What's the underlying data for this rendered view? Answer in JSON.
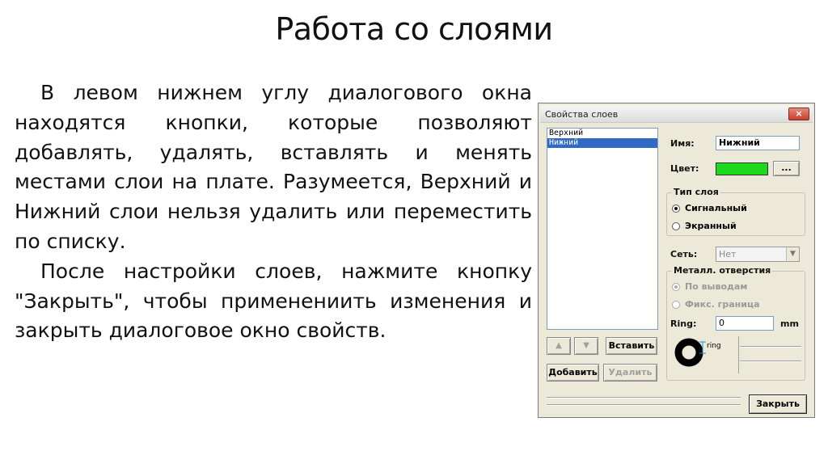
{
  "slide": {
    "title": "Работа со слоями",
    "paragraphs": [
      "В левом нижнем углу диалогового окна находятся кнопки, которые позволяют добавлять, удалять, вставлять и менять местами слои на плате. Разумеется, Верхний и Нижний слои нельзя удалить или переместить по списку.",
      "После настройки слоев, нажмите кнопку \"Закрыть\", чтобы применениить изменения и закрыть диалоговое окно свойств."
    ]
  },
  "dialog": {
    "title": "Свойства слоев",
    "close_glyph": "×",
    "layers": [
      "Верхний",
      "Нижний"
    ],
    "selected_layer": "Нижний",
    "name_label": "Имя:",
    "name_value": "Нижний",
    "color_label": "Цвет:",
    "color_value": "#1ed81e",
    "color_button": "...",
    "layer_type": {
      "legend": "Тип слоя",
      "options": [
        "Сигнальный",
        "Экранный"
      ],
      "selected": "Сигнальный"
    },
    "net_label": "Сеть:",
    "net_value": "Нет",
    "metal_holes": {
      "legend": "Металл. отверстия",
      "options": [
        "По выводам",
        "Фикс. граница"
      ],
      "selected": "По выводам"
    },
    "ring_label": "Ring:",
    "ring_value": "0",
    "ring_unit": "mm",
    "ring_diagram_label": "ring",
    "buttons": {
      "up": "▲",
      "down": "▼",
      "insert": "Вставить",
      "add": "Добавить",
      "delete": "Удалить",
      "close": "Закрыть"
    },
    "colors": {
      "dialog_bg": "#ece9d8",
      "selection": "#316ac5",
      "swatch": "#1ed81e"
    }
  }
}
